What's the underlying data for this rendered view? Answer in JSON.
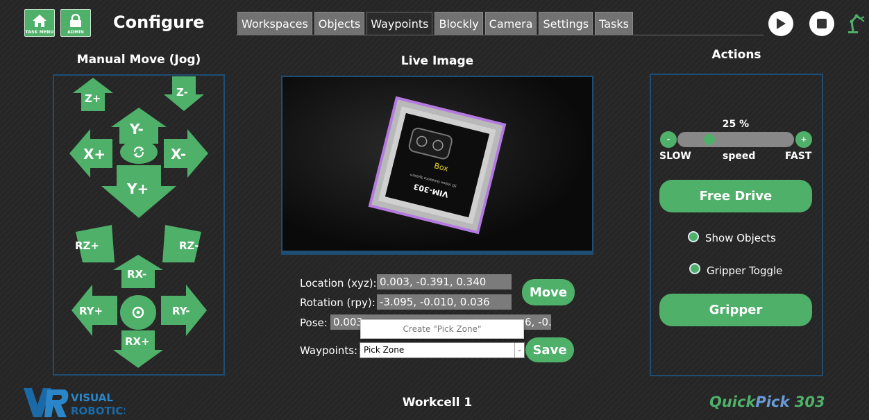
{
  "header": {
    "task_menu_label": "TASK MENU",
    "admin_label": "ADMIN",
    "title": "Configure",
    "tabs": [
      "Workspaces",
      "Objects",
      "Waypoints",
      "Blockly",
      "Camera",
      "Settings",
      "Tasks"
    ],
    "active_tab": "Waypoints"
  },
  "jog": {
    "heading": "Manual Move (Jog)",
    "z_plus": "Z+",
    "z_minus": "Z-",
    "y_minus": "Y-",
    "y_plus": "Y+",
    "x_plus": "X+",
    "x_minus": "X-",
    "rz_plus": "RZ+",
    "rz_minus": "RZ-",
    "rx_minus": "RX-",
    "rx_plus": "RX+",
    "ry_plus": "RY+",
    "ry_minus": "RY-"
  },
  "live": {
    "heading": "Live Image",
    "object_label": "Box",
    "product_text": "VIM-303",
    "product_subtext": "3D Vision Guidance System"
  },
  "fields": {
    "location_label": "Location (xyz):",
    "location_value": "0.003, -0.391, 0.340",
    "rotation_label": "Rotation (rpy):",
    "rotation_value": "-3.095, -0.010, 0.036",
    "pose_label": "Pose:",
    "pose_value_left": "0.003",
    "pose_value_right": "6, -0.(",
    "waypoints_label": "Waypoints:",
    "waypoints_selected": "Pick Zone",
    "dropdown_option": "Create \"Pick Zone\"",
    "move_label": "Move",
    "save_label": "Save"
  },
  "actions": {
    "heading": "Actions",
    "speed_percent_text": "25 %",
    "speed_value": 25,
    "minus_label": "-",
    "plus_label": "+",
    "slow_label": "SLOW",
    "speed_label": "speed",
    "fast_label": "FAST",
    "free_drive_label": "Free Drive",
    "show_objects_label": "Show Objects",
    "gripper_toggle_label": "Gripper Toggle",
    "gripper_label": "Gripper"
  },
  "footer": {
    "workcell": "Workcell 1",
    "logo_line1": "VISUAL",
    "logo_line2": "ROBOTICS",
    "brand_quick": "Quick",
    "brand_pick": "Pick",
    "brand_num": " 303"
  },
  "colors": {
    "accent_green": "#4fb06a",
    "panel_border": "#1f4e74",
    "tab_gray": "#727272",
    "brand_pick": "#6a9bd8"
  }
}
